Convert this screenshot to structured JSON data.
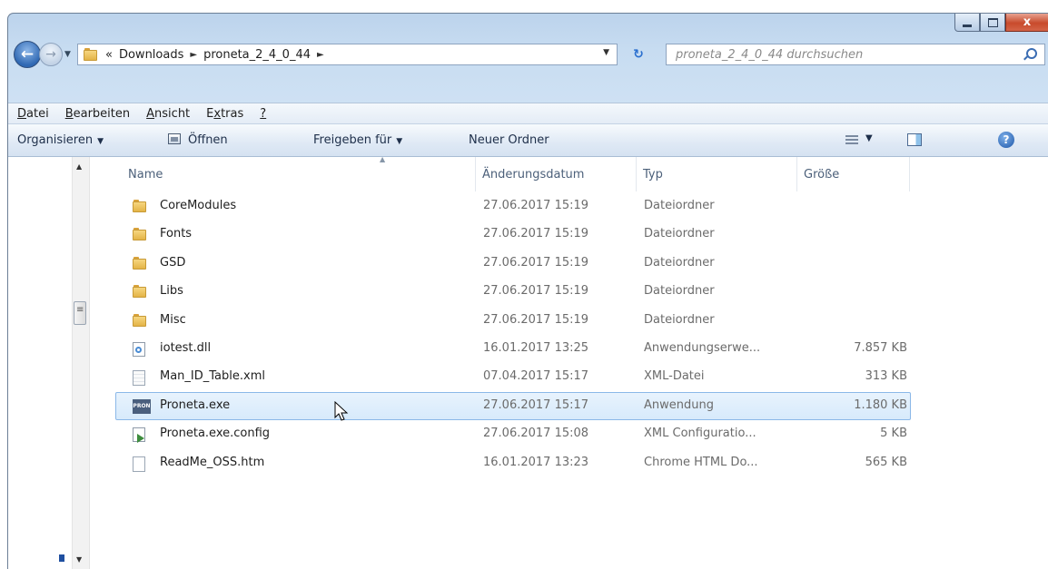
{
  "window": {
    "caption_buttons": {
      "minimize": "minimize",
      "maximize": "maximize",
      "close": "x"
    }
  },
  "nav": {
    "breadcrumb_overflow": "«",
    "breadcrumbs": [
      "Downloads",
      "proneta_2_4_0_44"
    ],
    "search_placeholder": "proneta_2_4_0_44 durchsuchen"
  },
  "menu": {
    "items": [
      {
        "underline": "D",
        "rest": "atei"
      },
      {
        "underline": "B",
        "rest": "earbeiten"
      },
      {
        "underline": "A",
        "rest": "nsicht"
      },
      {
        "pre": "E",
        "underline": "x",
        "rest": "tras"
      },
      {
        "underline": "?",
        "rest": ""
      }
    ]
  },
  "toolbar": {
    "organize": "Organisieren",
    "open": "Öffnen",
    "share": "Freigeben für",
    "new_folder": "Neuer Ordner"
  },
  "columns": {
    "name": "Name",
    "date": "Änderungsdatum",
    "type": "Typ",
    "size": "Größe"
  },
  "files": [
    {
      "name": "CoreModules",
      "date": "27.06.2017 15:19",
      "type": "Dateiordner",
      "size": "",
      "icon": "folder"
    },
    {
      "name": "Fonts",
      "date": "27.06.2017 15:19",
      "type": "Dateiordner",
      "size": "",
      "icon": "folder"
    },
    {
      "name": "GSD",
      "date": "27.06.2017 15:19",
      "type": "Dateiordner",
      "size": "",
      "icon": "folder"
    },
    {
      "name": "Libs",
      "date": "27.06.2017 15:19",
      "type": "Dateiordner",
      "size": "",
      "icon": "folder"
    },
    {
      "name": "Misc",
      "date": "27.06.2017 15:19",
      "type": "Dateiordner",
      "size": "",
      "icon": "folder"
    },
    {
      "name": "iotest.dll",
      "date": "16.01.2017 13:25",
      "type": "Anwendungserwe...",
      "size": "7.857 KB",
      "icon": "dll"
    },
    {
      "name": "Man_ID_Table.xml",
      "date": "07.04.2017 15:17",
      "type": "XML-Datei",
      "size": "313 KB",
      "icon": "xml"
    },
    {
      "name": "Proneta.exe",
      "date": "27.06.2017 15:17",
      "type": "Anwendung",
      "size": "1.180 KB",
      "icon": "exe",
      "selected": true
    },
    {
      "name": "Proneta.exe.config",
      "date": "27.06.2017 15:08",
      "type": "XML Configuratio...",
      "size": "5 KB",
      "icon": "config"
    },
    {
      "name": "ReadMe_OSS.htm",
      "date": "16.01.2017 13:23",
      "type": "Chrome HTML Do...",
      "size": "565 KB",
      "icon": "htm"
    }
  ]
}
